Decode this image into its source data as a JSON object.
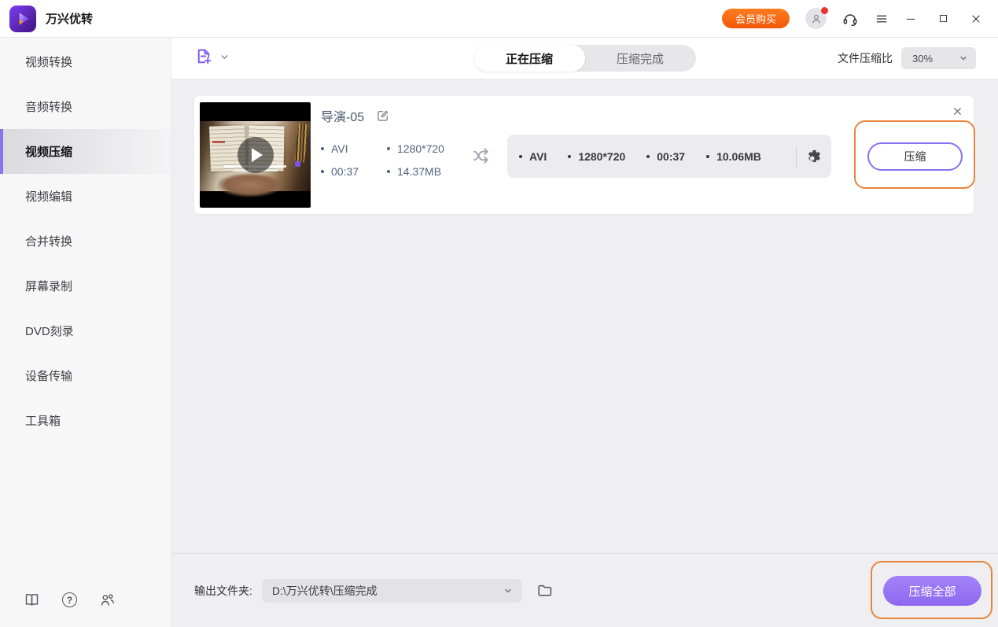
{
  "app": {
    "title": "万兴优转"
  },
  "header": {
    "buy_button": "会员购买"
  },
  "sidebar": {
    "items": [
      {
        "label": "视频转换",
        "active": false
      },
      {
        "label": "音频转换",
        "active": false
      },
      {
        "label": "视频压缩",
        "active": true
      },
      {
        "label": "视频编辑",
        "active": false
      },
      {
        "label": "合并转换",
        "active": false
      },
      {
        "label": "屏幕录制",
        "active": false
      },
      {
        "label": "DVD刻录",
        "active": false
      },
      {
        "label": "设备传输",
        "active": false
      },
      {
        "label": "工具箱",
        "active": false
      }
    ]
  },
  "toolbar": {
    "tabs": [
      {
        "label": "正在压缩",
        "active": true
      },
      {
        "label": "压缩完成",
        "active": false
      }
    ],
    "ratio_label": "文件压缩比",
    "ratio_value": "30%"
  },
  "task": {
    "title": "导演-05",
    "source": {
      "format": "AVI",
      "resolution": "1280*720",
      "duration": "00:37",
      "size": "14.37MB"
    },
    "target": {
      "format": "AVI",
      "resolution": "1280*720",
      "duration": "00:37",
      "size": "10.06MB"
    },
    "compress_button": "压缩"
  },
  "footer": {
    "output_label": "输出文件夹:",
    "output_path": "D:\\万兴优转\\压缩完成",
    "compress_all_button": "压缩全部"
  },
  "icons": {
    "help_glyph": "?"
  },
  "colors": {
    "accent_purple": "#8a70ee",
    "button_purple": "#8d68f0",
    "annotation_orange": "#e8843c",
    "buy_orange": "#f25708",
    "source_text": "#51637b"
  }
}
